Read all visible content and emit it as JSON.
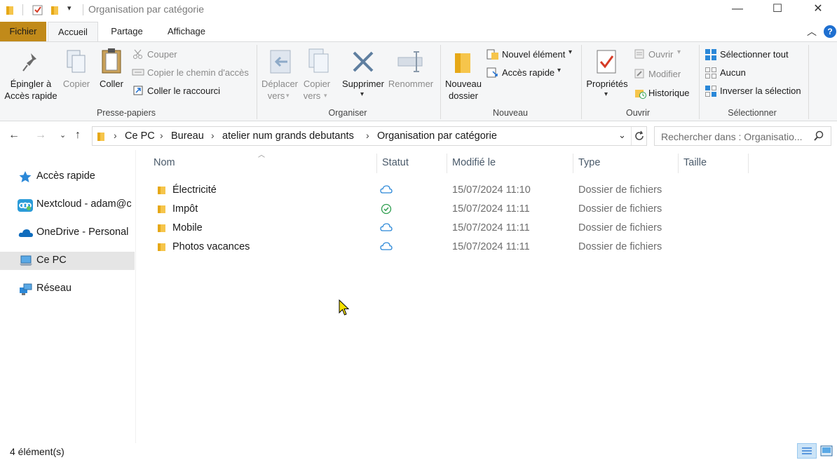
{
  "window": {
    "title": "Organisation par catégorie",
    "minimize": "—",
    "maximize": "☐",
    "close": "✕"
  },
  "tabs": [
    {
      "label": "Fichier"
    },
    {
      "label": "Accueil"
    },
    {
      "label": "Partage"
    },
    {
      "label": "Affichage"
    }
  ],
  "ribbon": {
    "presse_papiers": {
      "title": "Presse-papiers",
      "pin_line1": "Épingler à",
      "pin_line2": "Accès rapide",
      "copy": "Copier",
      "paste": "Coller",
      "cut": "Couper",
      "copy_path": "Copier le chemin d'accès",
      "paste_shortcut": "Coller le raccourci"
    },
    "organiser": {
      "title": "Organiser",
      "move_line1": "Déplacer",
      "move_line2": "vers",
      "copyto_line1": "Copier",
      "copyto_line2": "vers",
      "delete": "Supprimer",
      "rename": "Renommer"
    },
    "nouveau": {
      "title": "Nouveau",
      "new_folder_line1": "Nouveau",
      "new_folder_line2": "dossier",
      "new_item": "Nouvel élément",
      "easy_access": "Accès rapide"
    },
    "ouvrir": {
      "title": "Ouvrir",
      "properties": "Propriétés",
      "open": "Ouvrir",
      "edit": "Modifier",
      "history": "Historique"
    },
    "selectionner": {
      "title": "Sélectionner",
      "select_all": "Sélectionner tout",
      "select_none": "Aucun",
      "invert": "Inverser la sélection"
    }
  },
  "breadcrumb": [
    {
      "label": "Ce PC"
    },
    {
      "label": "Bureau"
    },
    {
      "label": "atelier num grands debutants"
    },
    {
      "label": "Organisation par catégorie"
    }
  ],
  "search": {
    "placeholder": "Rechercher dans : Organisatio..."
  },
  "sidebar": {
    "items": [
      {
        "label": "Accès rapide",
        "icon": "star-icon"
      },
      {
        "label": "Nextcloud - adam@c",
        "icon": "nextcloud-icon"
      },
      {
        "label": "OneDrive - Personal",
        "icon": "onedrive-icon"
      },
      {
        "label": "Ce PC",
        "icon": "computer-icon"
      },
      {
        "label": "Réseau",
        "icon": "network-icon"
      }
    ]
  },
  "columns": {
    "name": "Nom",
    "status": "Statut",
    "modified": "Modifié le",
    "type": "Type",
    "size": "Taille"
  },
  "files": [
    {
      "name": "Électricité",
      "status": "cloud-icon",
      "modified": "15/07/2024 11:10",
      "type": "Dossier de fichiers"
    },
    {
      "name": "Impôt",
      "status": "synced-check-icon",
      "modified": "15/07/2024 11:11",
      "type": "Dossier de fichiers"
    },
    {
      "name": "Mobile",
      "status": "cloud-icon",
      "modified": "15/07/2024 11:11",
      "type": "Dossier de fichiers"
    },
    {
      "name": "Photos vacances",
      "status": "cloud-icon",
      "modified": "15/07/2024 11:11",
      "type": "Dossier de fichiers"
    }
  ],
  "statusbar": {
    "count": "4 élément(s)"
  },
  "colors": {
    "fichier_tab": "#c18a1a",
    "folder": "#f6c54b",
    "cloud": "#2b88d8",
    "check": "#2e9e4f"
  }
}
